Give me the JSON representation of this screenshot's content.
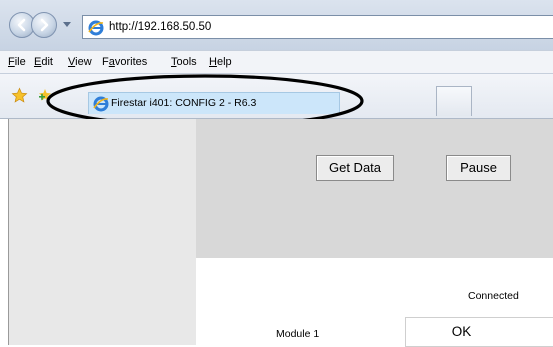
{
  "browser": {
    "address": "http://192.168.50.50",
    "menu": [
      "File",
      "Edit",
      "View",
      "Favorites",
      "Tools",
      "Help"
    ],
    "tab_title": "Firestar i401: CONFIG 2 - R6.3"
  },
  "page": {
    "get_data_label": "Get Data",
    "pause_label": "Pause",
    "status_header": "Connected",
    "module_name": "Module 1",
    "module_status": "OK"
  },
  "colors": {
    "chrome": "#dbe3ee",
    "active_tab": "#cce6fa",
    "control_panel": "#d8d8d8",
    "left_pane": "#e8e8e8",
    "annotation_ellipse": "#000000"
  },
  "icons": [
    "back-icon",
    "forward-icon",
    "dropdown-arrow-icon",
    "ie-icon",
    "favorites-star-icon",
    "add-favorites-icon"
  ]
}
